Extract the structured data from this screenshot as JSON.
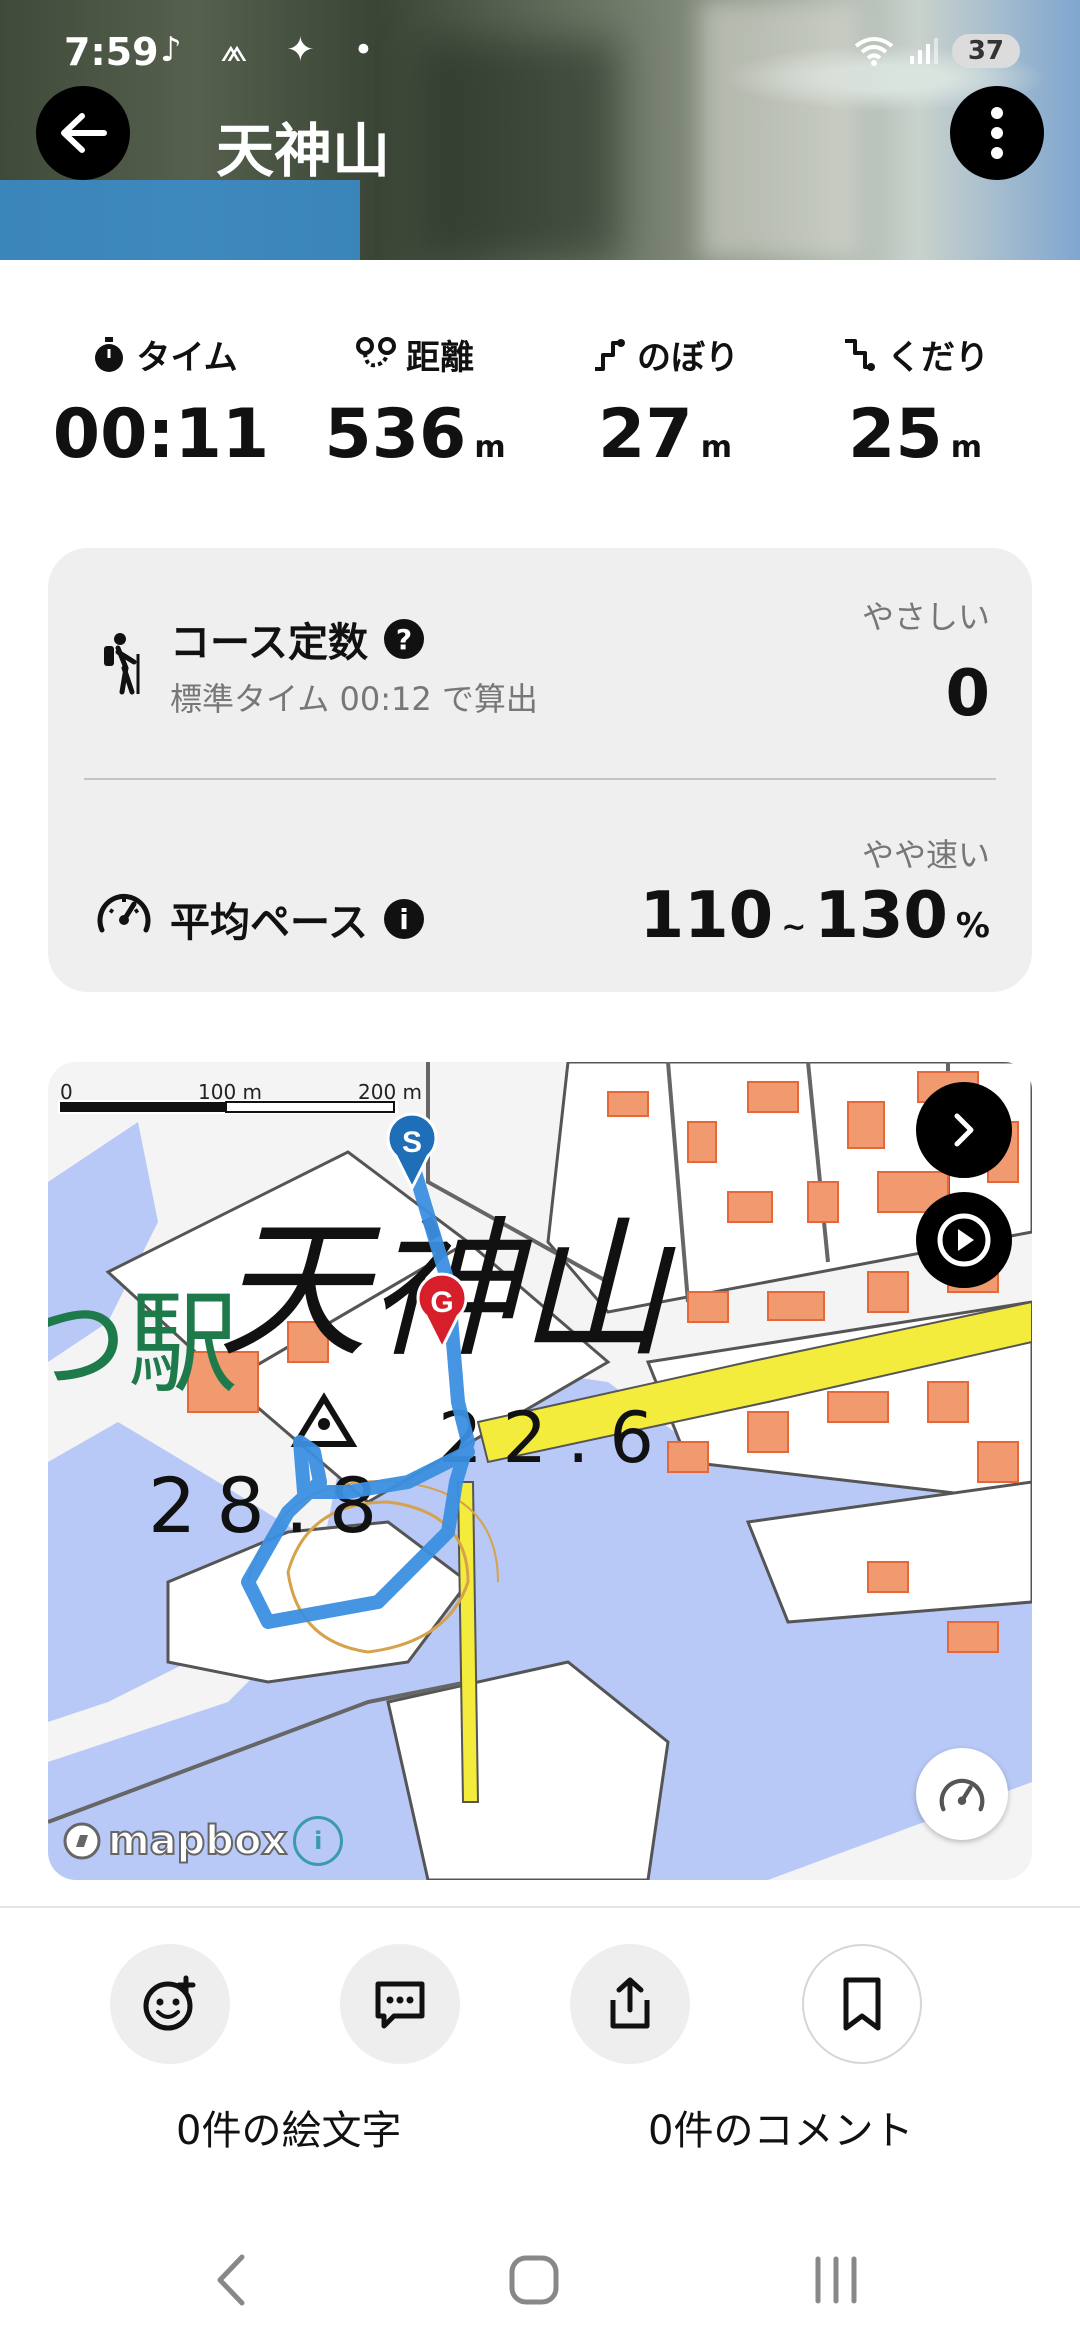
{
  "status_bar": {
    "time": "7:59",
    "left_icons": "♪ ⩕ ✦ •",
    "battery": "37"
  },
  "header": {
    "title": "天神山"
  },
  "stats": [
    {
      "label": "タイム",
      "value": "00:11",
      "unit": "",
      "icon": "stopwatch-icon"
    },
    {
      "label": "距離",
      "value": "536",
      "unit": "m",
      "icon": "route-icon"
    },
    {
      "label": "のぼり",
      "value": "27",
      "unit": "m",
      "icon": "ascent-icon"
    },
    {
      "label": "くだり",
      "value": "25",
      "unit": "m",
      "icon": "descent-icon"
    }
  ],
  "course": {
    "title": "コース定数",
    "help": "?",
    "subtitle": "標準タイム 00:12 で算出",
    "grade": "やさしい",
    "value": "0"
  },
  "pace": {
    "title": "平均ペース",
    "info": "i",
    "grade": "やや速い",
    "min": "110",
    "sep": "~",
    "max": "130",
    "unit": "%"
  },
  "map": {
    "scale_labels": [
      "0",
      "100 m",
      "200 m"
    ],
    "place_name": "天神山",
    "station_text": "つ駅",
    "elev_1": "28.8",
    "elev_2": "22.6",
    "start_marker": "S",
    "goal_marker": "G",
    "attribution": "mapbox",
    "attribution_info": "i",
    "route_color": "#3b8fe0",
    "road_color": "#f4ec3c",
    "water_color": "#b9c9f7",
    "building_color": "#f19a70"
  },
  "actions": {
    "emoji_label": "0件の絵文字",
    "comment_label": "0件のコメント"
  }
}
